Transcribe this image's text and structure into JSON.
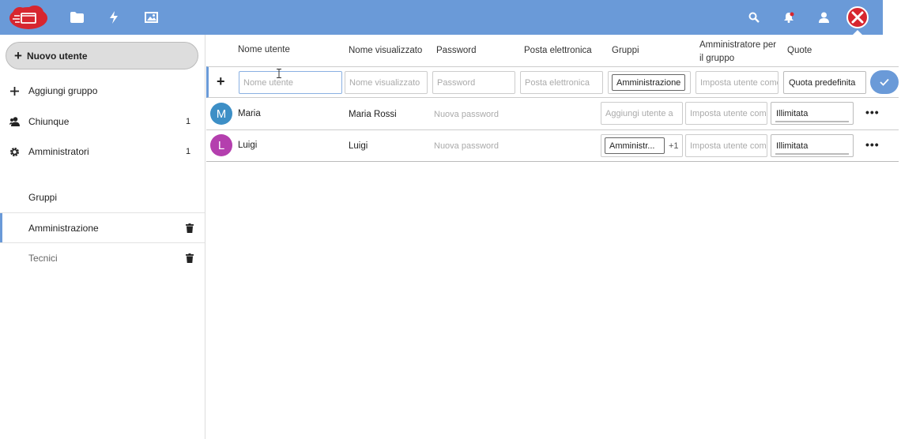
{
  "header": {
    "icons": [
      "logo",
      "files-icon",
      "activity-icon",
      "gallery-icon",
      "search-icon",
      "notifications-icon",
      "contacts-icon",
      "user-avatar"
    ]
  },
  "sidebar": {
    "new_user_label": "Nuovo utente",
    "add_group_label": "Aggiungi gruppo",
    "everyone": {
      "label": "Chiunque",
      "count": "1"
    },
    "admins": {
      "label": "Amministratori",
      "count": "1"
    },
    "groups_title": "Gruppi",
    "groups": [
      {
        "label": "Amministrazione"
      },
      {
        "label": "Tecnici"
      }
    ]
  },
  "columns": {
    "username": "Nome utente",
    "display_name": "Nome visualizzato",
    "password": "Password",
    "email": "Posta elettronica",
    "groups": "Gruppi",
    "group_admin": "Amministratore per il gruppo",
    "quota": "Quote"
  },
  "new_user_form": {
    "username_placeholder": "Nome utente",
    "display_name_placeholder": "Nome visualizzato",
    "password_placeholder": "Password",
    "email_placeholder": "Posta elettronica",
    "group_tag": "Amministrazione",
    "group_admin_placeholder": "Imposta utente come",
    "quota_value": "Quota predefinita"
  },
  "users": [
    {
      "initial": "M",
      "avatar_color": "#3d8fc6",
      "username": "Maria",
      "display_name": "Maria Rossi",
      "password_placeholder": "Nuova password",
      "groups_placeholder": "Aggiungi utente a",
      "group_admin_placeholder": "Imposta utente come",
      "quota": "Illimitata"
    },
    {
      "initial": "L",
      "avatar_color": "#b43fae",
      "username": "Luigi",
      "display_name": "Luigi",
      "password_placeholder": "Nuova password",
      "group_tag": "Amministr...",
      "group_more": "+1",
      "group_admin_placeholder": "Imposta utente come",
      "quota": "Illimitata"
    }
  ],
  "colors": {
    "accent": "#6a9ad8",
    "avatar_bg": "#d7262f"
  }
}
